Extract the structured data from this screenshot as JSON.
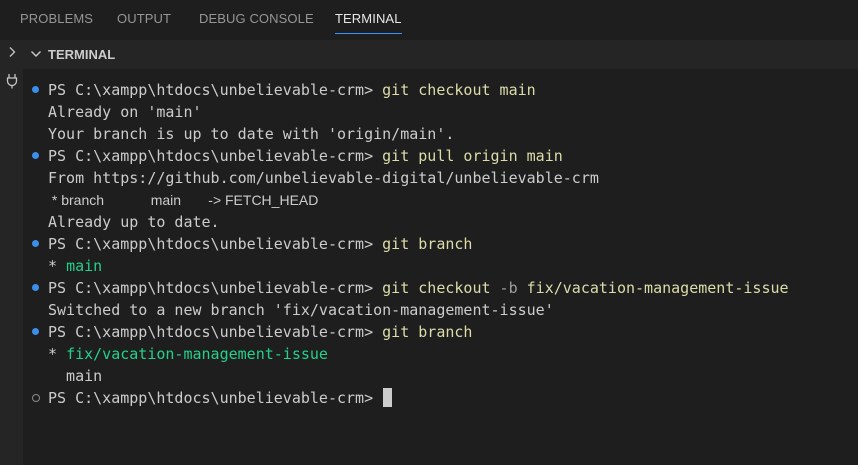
{
  "tabs": [
    {
      "label": "PROBLEMS"
    },
    {
      "label": "OUTPUT"
    },
    {
      "label": "DEBUG CONSOLE"
    },
    {
      "label": "TERMINAL",
      "active": true
    }
  ],
  "activity_bar": {
    "icons": [
      "chevron-right-icon",
      "plug-icon"
    ]
  },
  "panel": {
    "title": "TERMINAL"
  },
  "terminal": {
    "prompt": "PS C:\\xampp\\htdocs\\unbelievable-crm>",
    "lines": [
      {
        "cmd": "git checkout main"
      },
      {
        "out": "Already on 'main'"
      },
      {
        "out": "Your branch is up to date with 'origin/main'."
      },
      {
        "cmd": "git pull origin main"
      },
      {
        "out": "From https://github.com/unbelievable-digital/unbelievable-crm"
      },
      {
        "out_mono": " * branch            main       -> FETCH_HEAD"
      },
      {
        "out": "Already up to date."
      },
      {
        "cmd": "git branch"
      },
      {
        "star": "* ",
        "branch": "main"
      },
      {
        "cmd_git": "git checkout",
        "cmd_flag": "-b",
        "cmd_rest": "fix/vacation-management-issue"
      },
      {
        "out": "Switched to a new branch 'fix/vacation-management-issue'"
      },
      {
        "cmd": "git branch"
      },
      {
        "star": "* ",
        "branch": "fix/vacation-management-issue"
      },
      {
        "out": "  main"
      },
      {
        "cmd": ""
      }
    ]
  },
  "colors": {
    "background": "#1e1e1e",
    "command": "#dcdcaa",
    "branch_current": "#23d18b",
    "decoration_success": "#3b8eea",
    "tab_active_underline": "#3794ff"
  }
}
